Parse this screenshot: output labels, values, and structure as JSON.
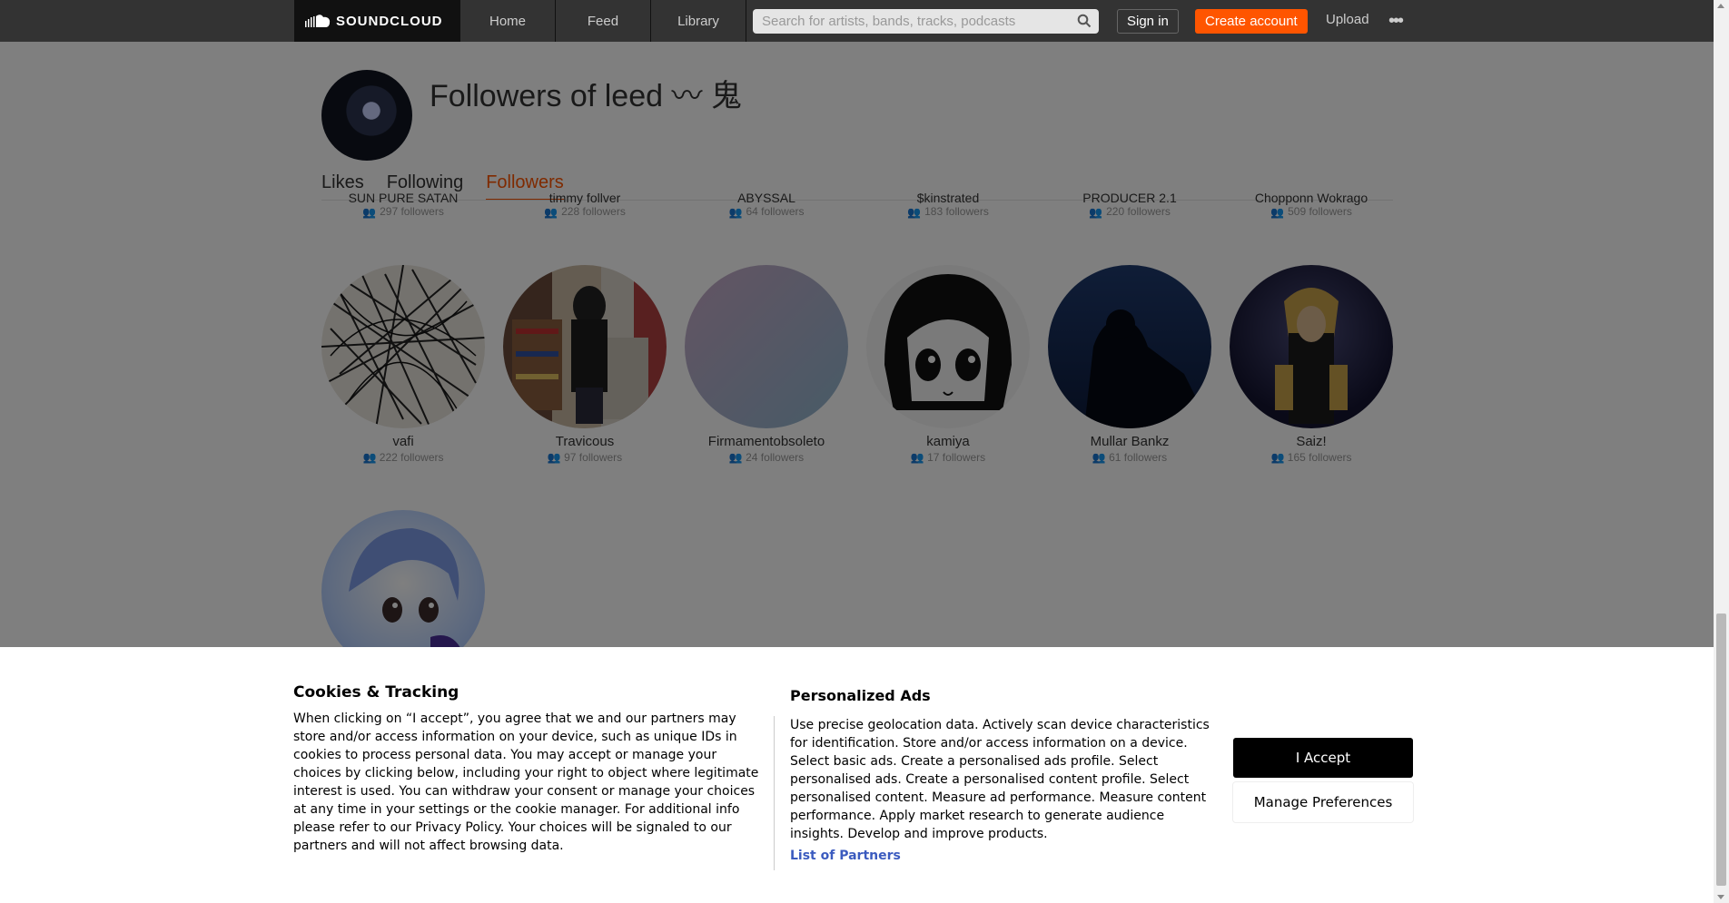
{
  "nav": {
    "logo_text": "SOUNDCLOUD",
    "items": [
      "Home",
      "Feed",
      "Library"
    ],
    "search_placeholder": "Search for artists, bands, tracks, podcasts",
    "signin": "Sign in",
    "create_account": "Create account",
    "upload": "Upload",
    "more": "•••"
  },
  "profile": {
    "title": "Followers of leed 〰 鬼",
    "tabs": [
      {
        "label": "Likes",
        "active": false
      },
      {
        "label": "Following",
        "active": false
      },
      {
        "label": "Followers",
        "active": true
      }
    ]
  },
  "top_row_partial": [
    {
      "name": "SUN PURE SATAN",
      "followers": "297 followers"
    },
    {
      "name": "timmy follver",
      "followers": "228 followers"
    },
    {
      "name": "ABYSSAL",
      "followers": "64 followers"
    },
    {
      "name": "$kinstrated",
      "followers": "183 followers"
    },
    {
      "name": "PRODUCER 2.1",
      "followers": "220 followers"
    },
    {
      "name": "Chopponn Wokrago",
      "followers": "509 followers"
    }
  ],
  "followers": [
    {
      "name": "vafi",
      "followers": "222 followers"
    },
    {
      "name": "Travicous",
      "followers": "97 followers"
    },
    {
      "name": "Firmamentobsoleto",
      "followers": "24 followers"
    },
    {
      "name": "kamiya",
      "followers": "17 followers"
    },
    {
      "name": "Mullar Bankz",
      "followers": "61 followers"
    },
    {
      "name": "Saiz!",
      "followers": "165 followers"
    }
  ],
  "cookie": {
    "title": "Cookies & Tracking",
    "text": "When clicking on “I accept”, you agree that we and our partners may store and/or access information on your device, such as unique IDs in cookies to process personal data. You may accept or manage your choices by clicking below, including your right to object where legitimate interest is used. You can withdraw your consent or manage your choices at any time in your settings or the cookie manager. For additional info please refer to our Privacy Policy. Your choices will be signaled to our partners and will not affect browsing data.",
    "ads_title": "Personalized Ads",
    "ads_text": "Use precise geolocation data. Actively scan device characteristics for identification. Store and/or access information on a device. Select basic ads. Create a personalised ads profile. Select personalised ads. Create a personalised content profile. Select personalised content. Measure ad performance. Measure content performance. Apply market research to generate audience insights. Develop and improve products.",
    "partners_link": "List of Partners",
    "accept": "I Accept",
    "manage": "Manage Preferences"
  },
  "colors": {
    "brand": "#ff5500",
    "topbar": "#333333",
    "accept_bg": "#000000"
  }
}
